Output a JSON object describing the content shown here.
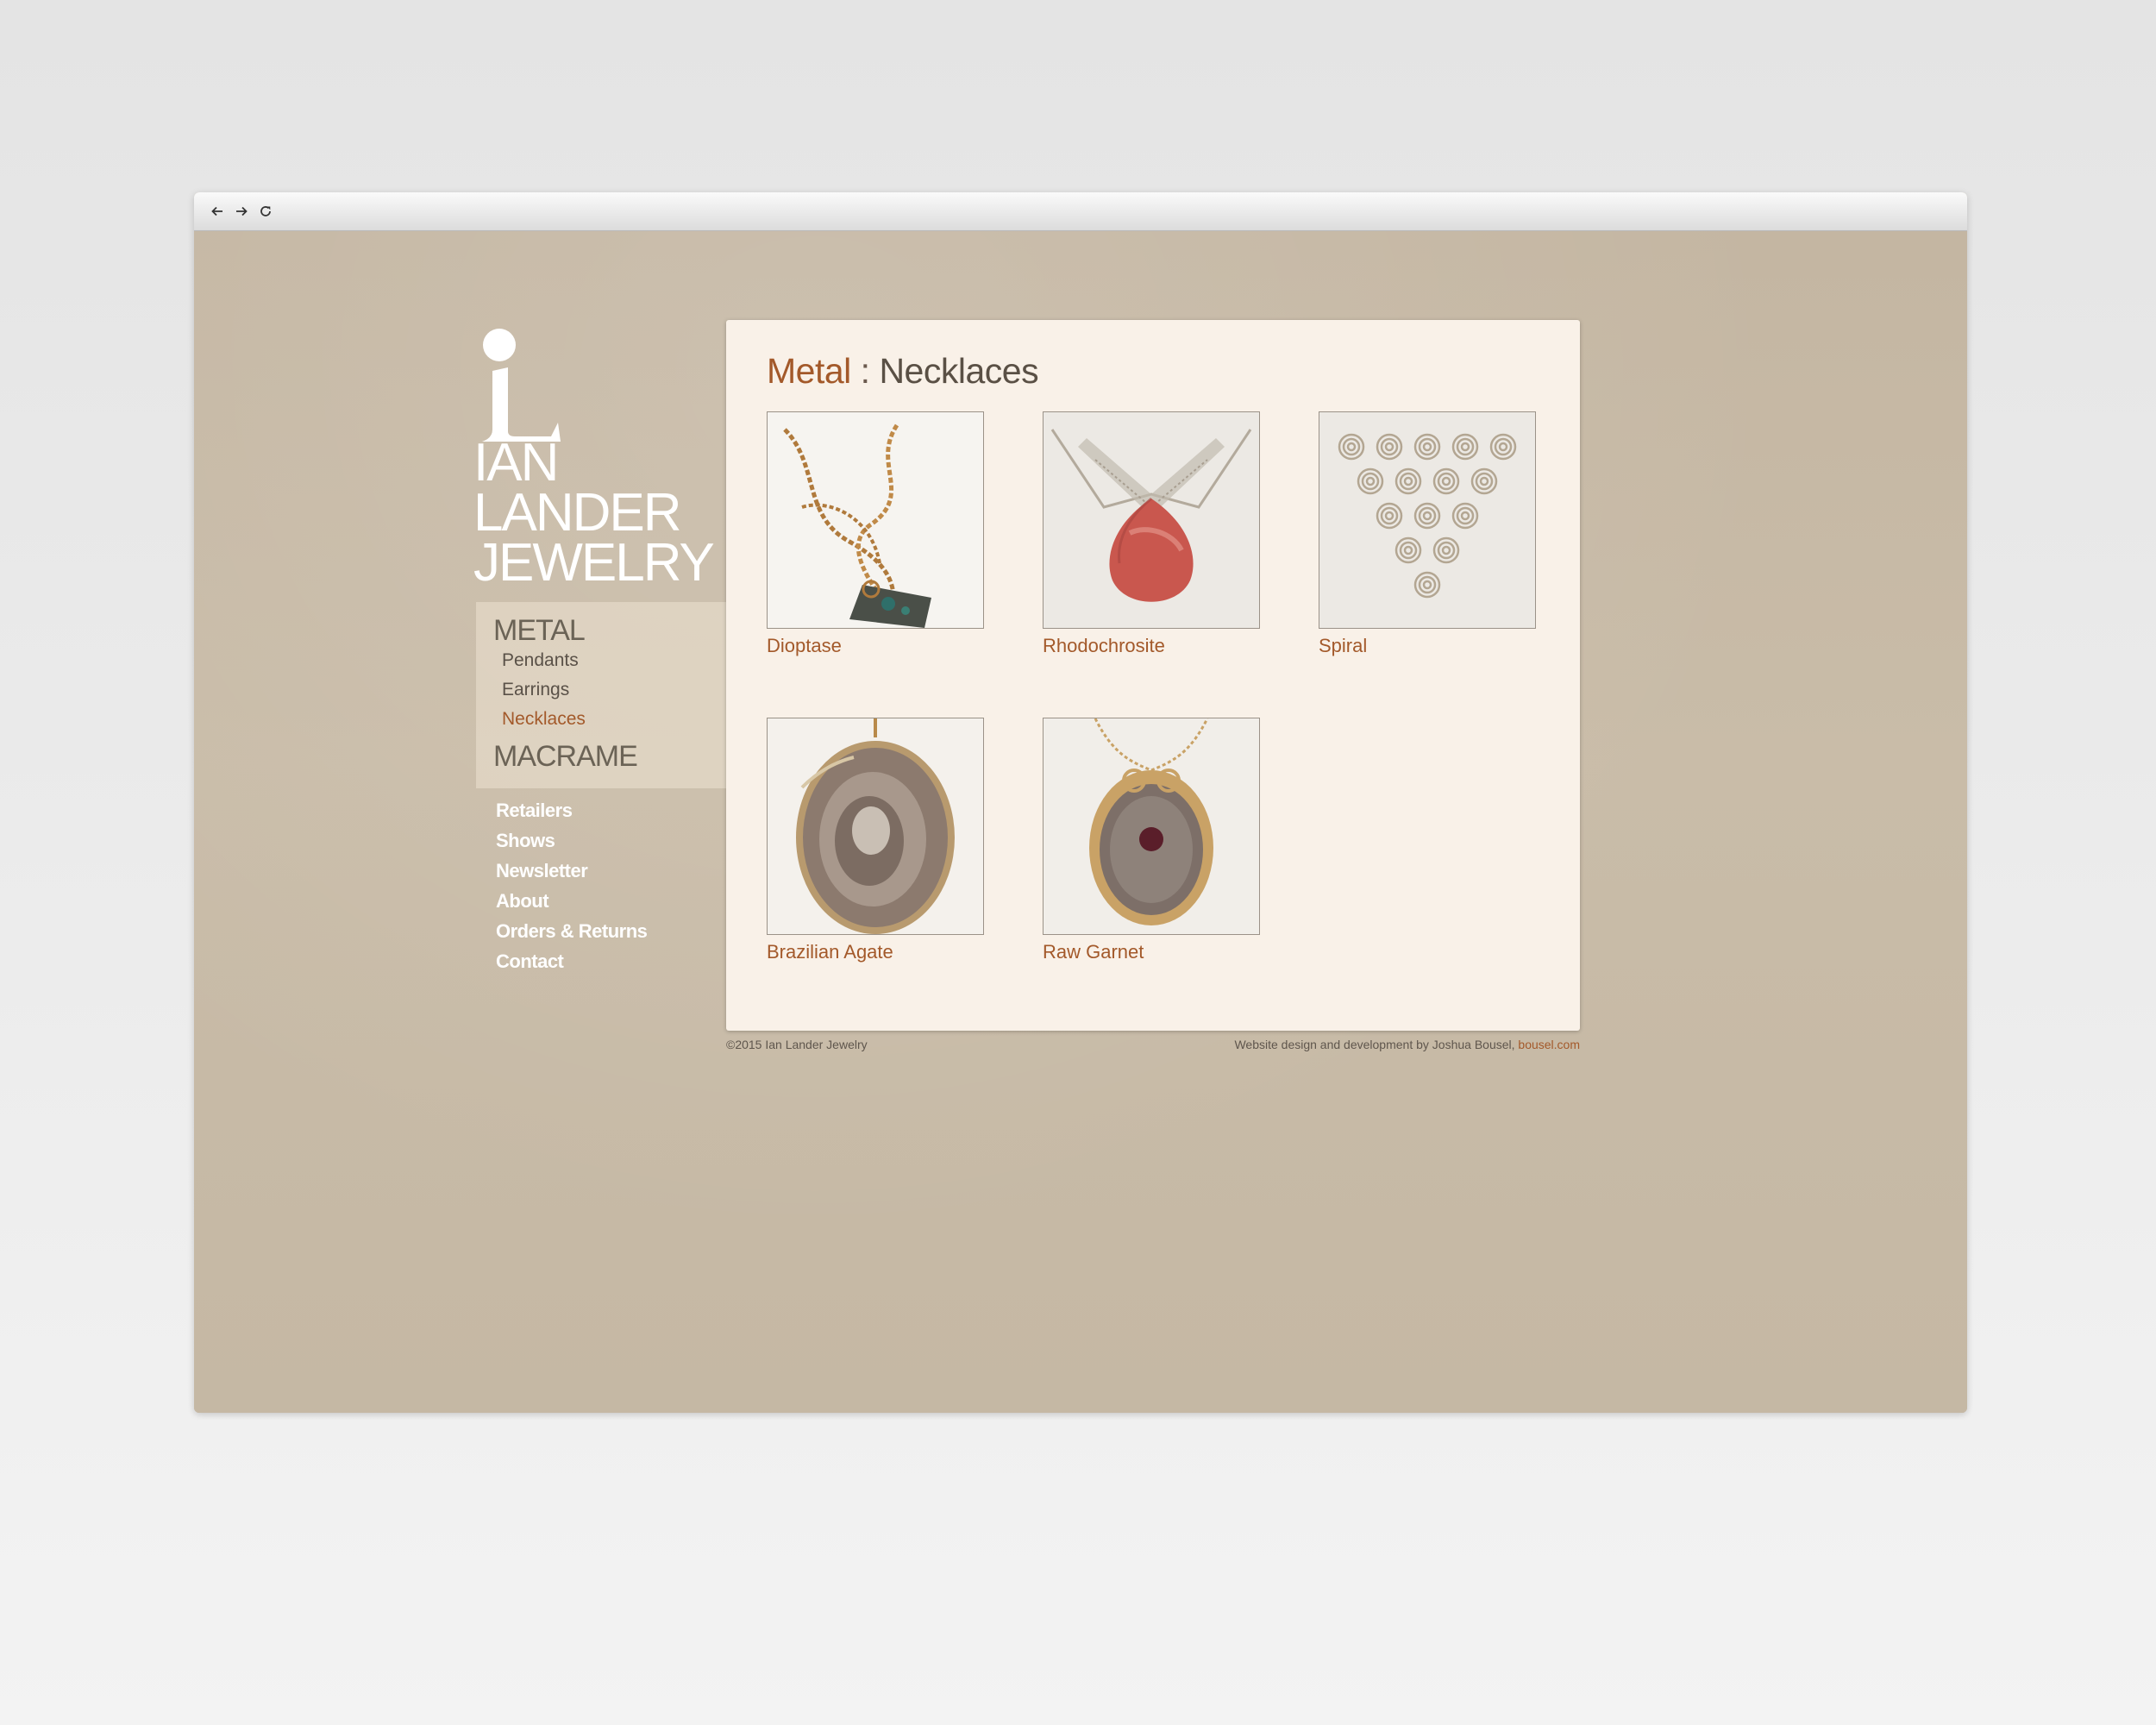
{
  "browser": {
    "nav": [
      "back-arrow-icon",
      "forward-arrow-icon",
      "reload-icon"
    ]
  },
  "logo": {
    "lines": [
      "IAN",
      "LANDER",
      "JEWELRY"
    ]
  },
  "sidebar": {
    "categories": [
      {
        "label": "METAL",
        "items": [
          "Pendants",
          "Earrings",
          "Necklaces"
        ],
        "active": "Necklaces"
      },
      {
        "label": "MACRAME"
      }
    ],
    "menu": [
      "Retailers",
      "Shows",
      "Newsletter",
      "About",
      "Orders & Returns",
      "Contact"
    ]
  },
  "content": {
    "crumb": "Metal",
    "separator": " : ",
    "title": "Necklaces",
    "products": [
      {
        "name": "Dioptase",
        "photo": "chain-pendant-dioptase"
      },
      {
        "name": "Rhodochrosite",
        "photo": "mesh-pendant-rhodochrosite"
      },
      {
        "name": "Spiral",
        "photo": "spiral-bib-necklace"
      },
      {
        "name": "Brazilian Agate",
        "photo": "agate-slice-pendant"
      },
      {
        "name": "Raw Garnet",
        "photo": "garnet-wire-pendant"
      }
    ]
  },
  "footer": {
    "copyright": "©2015 Ian Lander Jewelry",
    "credit": "Website design and development by Joshua Bousel, ",
    "credit_link": "bousel.com"
  },
  "colors": {
    "accent": "#a3592a",
    "background": "#c5b8a3",
    "panel": "#f9f1e8"
  }
}
